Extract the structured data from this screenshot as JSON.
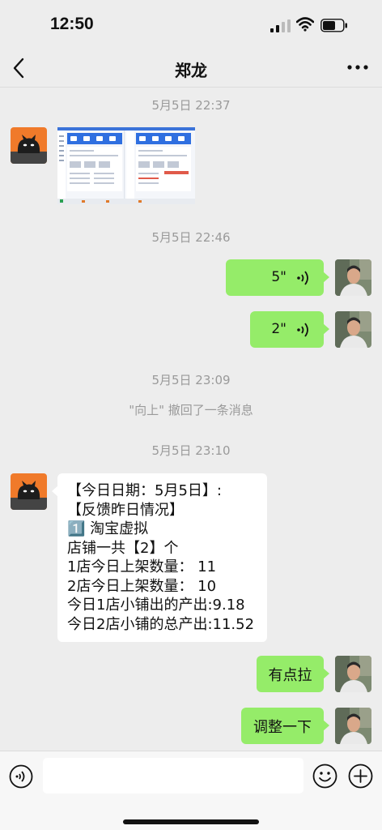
{
  "status_bar": {
    "time": "12:50"
  },
  "nav": {
    "title": "郑龙"
  },
  "messages": {
    "ts1": "5月5日 22:37",
    "ts2": "5月5日 22:46",
    "voice1": "5\"",
    "voice2": "2\"",
    "ts3": "5月5日 23:09",
    "recall": "\"向上\" 撤回了一条消息",
    "ts4": "5月5日 23:10",
    "report_lines": [
      "【今日日期：5月5日】:",
      "【反馈昨日情况】",
      "1️⃣ 淘宝虚拟",
      "店铺一共【2】个",
      "1店今日上架数量： 11",
      "2店今日上架数量： 10",
      "今日1店小铺出的产出:9.18",
      "今日2店小铺的总产出:11.52"
    ],
    "reply1": "有点拉",
    "reply2": "调整一下"
  },
  "colors": {
    "accent_green": "#95ec69",
    "background": "#ededed"
  },
  "icons": [
    "signal-icon",
    "wifi-icon",
    "battery-icon",
    "back-arrow-icon",
    "more-icon",
    "voice-wave-icon",
    "emoji-icon",
    "plus-icon"
  ]
}
